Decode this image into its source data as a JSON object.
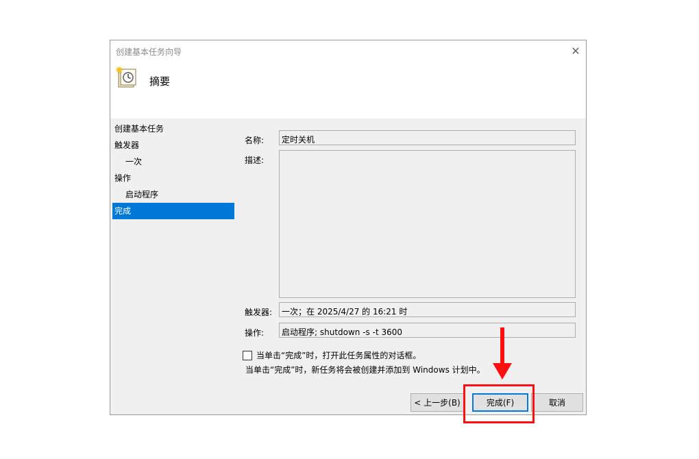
{
  "window": {
    "title": "创建基本任务向导",
    "close_icon": "✕"
  },
  "header": {
    "title": "摘要",
    "icon": "task-clock-icon"
  },
  "steps": [
    {
      "label": "创建基本任务",
      "level": 0,
      "active": false
    },
    {
      "label": "触发器",
      "level": 0,
      "active": false
    },
    {
      "label": "一次",
      "level": 1,
      "active": false
    },
    {
      "label": "操作",
      "level": 0,
      "active": false
    },
    {
      "label": "启动程序",
      "level": 1,
      "active": false
    },
    {
      "label": "完成",
      "level": 0,
      "active": true
    }
  ],
  "fields": {
    "name_label": "名称:",
    "name_value": "定时关机",
    "description_label": "描述:",
    "description_value": "",
    "trigger_label": "触发器:",
    "trigger_value": "一次；在 2025/4/27 的 16:21 时",
    "action_label": "操作:",
    "action_value": "启动程序; shutdown -s -t 3600"
  },
  "checkbox": {
    "label": "当单击“完成”时，打开此任务属性的对话框。",
    "checked": false
  },
  "info_text": "当单击“完成”时，新任务将会被创建并添加到 Windows 计划中。",
  "buttons": {
    "back": "< 上一步(B)",
    "finish": "完成(F)",
    "cancel": "取消"
  },
  "colors": {
    "accent": "#0078d7",
    "annotation": "#ff1010"
  }
}
